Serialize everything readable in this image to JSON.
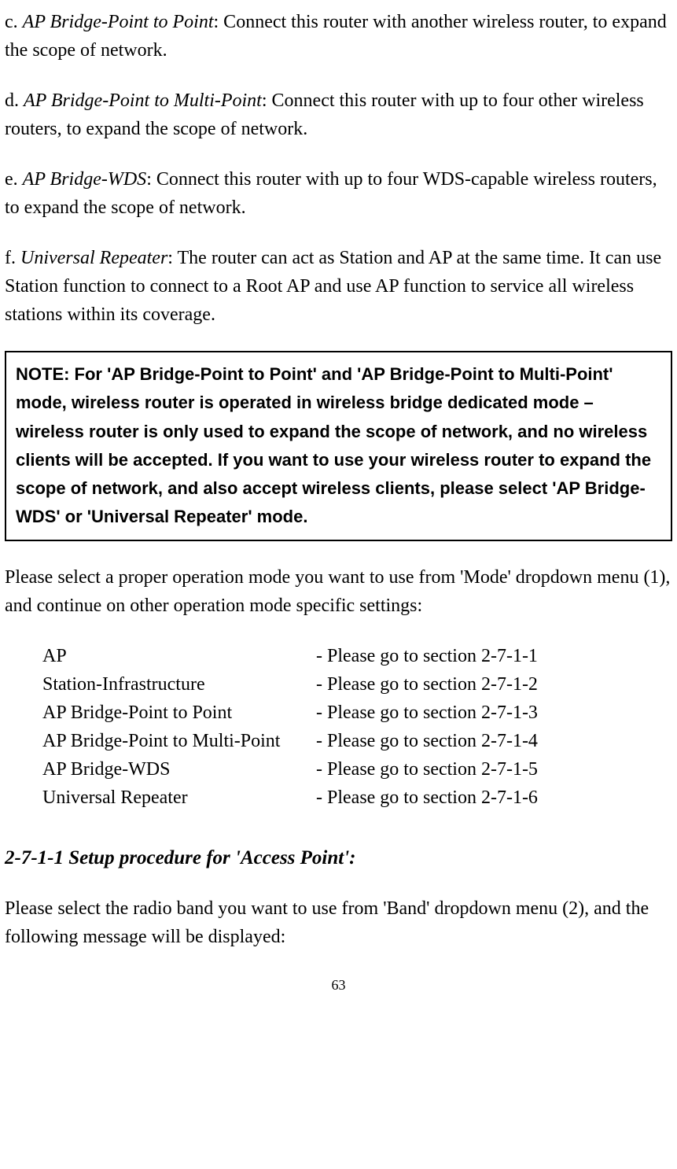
{
  "para_c_prefix": "c. ",
  "para_c_term": "AP Bridge-Point to Point",
  "para_c_rest": ": Connect this router with another wireless router, to expand the scope of network.",
  "para_d_prefix": "d. ",
  "para_d_term": "AP Bridge-Point to Multi-Point",
  "para_d_rest": ": Connect this router with up to four other wireless routers, to expand the scope of network.",
  "para_e_prefix": "e. ",
  "para_e_term": "AP Bridge-WDS",
  "para_e_rest": ": Connect this router with up to four WDS-capable wireless routers, to expand the scope of network.",
  "para_f_prefix": "f. ",
  "para_f_term": "Universal Repeater",
  "para_f_rest": ": The router can act as Station and AP at the same time. It can use Station function to connect to a Root AP and use AP function to service all wireless stations within its coverage.",
  "note_text": "NOTE: For 'AP Bridge-Point to Point' and 'AP Bridge-Point to Multi-Point' mode, wireless router is operated in wireless bridge dedicated mode – wireless router is only used to expand the scope of network, and no wireless clients will be accepted. If you want to use your wireless router to expand the scope of network, and also accept wireless clients, please select 'AP Bridge-WDS' or 'Universal Repeater' mode.",
  "select_intro": "Please select a proper operation mode you want to use from 'Mode' dropdown menu (1), and continue on other operation mode specific settings:",
  "modes": {
    "row0": {
      "label": "AP",
      "ref": "- Please go to section 2-7-1-1"
    },
    "row1": {
      "label": "Station-Infrastructure",
      "ref": "- Please go to section 2-7-1-2"
    },
    "row2": {
      "label": "AP Bridge-Point to Point",
      "ref": "- Please go to section 2-7-1-3"
    },
    "row3": {
      "label": "AP Bridge-Point to Multi-Point",
      "ref": "- Please go to section 2-7-1-4"
    },
    "row4": {
      "label": "AP Bridge-WDS",
      "ref": "- Please go to section 2-7-1-5"
    },
    "row5": {
      "label": "Universal Repeater",
      "ref": "- Please go to section 2-7-1-6"
    }
  },
  "section_heading": "2-7-1-1 Setup procedure for 'Access Point':",
  "band_intro": "Please select the radio band you want to use from 'Band' dropdown menu (2), and the following message will be displayed:",
  "page_number": "63"
}
